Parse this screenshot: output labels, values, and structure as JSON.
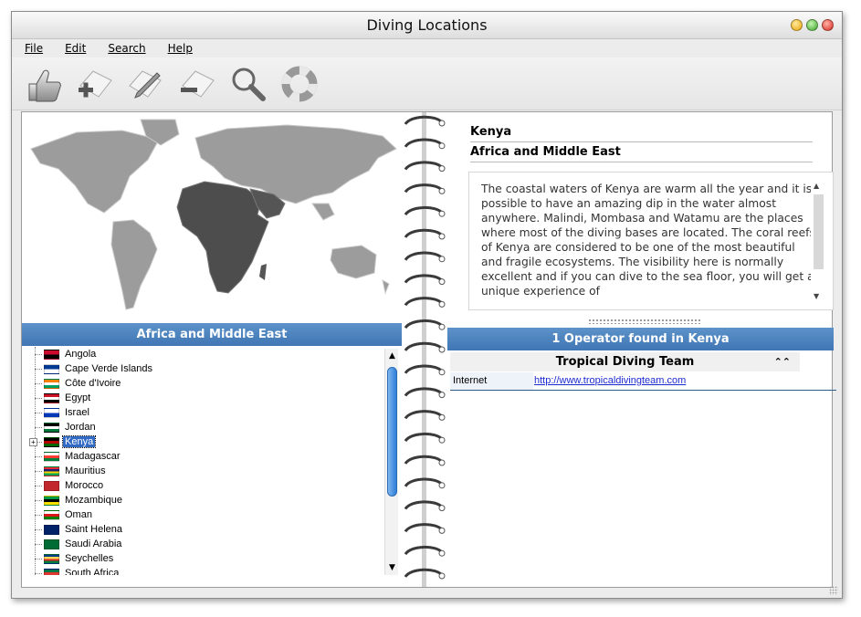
{
  "window": {
    "title": "Diving Locations"
  },
  "menubar": {
    "items": [
      "File",
      "Edit",
      "Search",
      "Help"
    ]
  },
  "toolbar": {
    "tools": [
      "thumbs-up-icon",
      "add-location-icon",
      "edit-location-icon",
      "remove-location-icon",
      "magnifier-icon",
      "lifebuoy-icon"
    ]
  },
  "left_panel": {
    "region_title": "Africa and Middle East",
    "countries": [
      {
        "label": "Angola",
        "flag": [
          "#cc092f",
          "#000000"
        ]
      },
      {
        "label": "Cape Verde Islands",
        "flag": [
          "#003893",
          "#ffffff"
        ]
      },
      {
        "label": "Côte d'Ivoire",
        "flag": [
          "#f77f00",
          "#ffffff",
          "#009e60"
        ]
      },
      {
        "label": "Egypt",
        "flag": [
          "#ce1126",
          "#ffffff",
          "#000000"
        ]
      },
      {
        "label": "Israel",
        "flag": [
          "#ffffff",
          "#0038b8"
        ]
      },
      {
        "label": "Jordan",
        "flag": [
          "#000000",
          "#ffffff",
          "#007a3d"
        ]
      },
      {
        "label": "Kenya",
        "flag": [
          "#000000",
          "#bb0000",
          "#006600"
        ],
        "selected": true,
        "expandable": true
      },
      {
        "label": "Madagascar",
        "flag": [
          "#ffffff",
          "#fc3d32",
          "#007e3a"
        ]
      },
      {
        "label": "Mauritius",
        "flag": [
          "#ea2839",
          "#1a206d",
          "#ffd500",
          "#00a551"
        ]
      },
      {
        "label": "Morocco",
        "flag": [
          "#c1272d"
        ]
      },
      {
        "label": "Mozambique",
        "flag": [
          "#009a44",
          "#000000",
          "#fce100"
        ]
      },
      {
        "label": "Oman",
        "flag": [
          "#ffffff",
          "#db161b",
          "#008000"
        ]
      },
      {
        "label": "Saint Helena",
        "flag": [
          "#012169"
        ]
      },
      {
        "label": "Saudi Arabia",
        "flag": [
          "#006c35"
        ]
      },
      {
        "label": "Seychelles",
        "flag": [
          "#003f87",
          "#fcd856",
          "#d62828",
          "#007a3d"
        ]
      },
      {
        "label": "South Africa",
        "flag": [
          "#007749",
          "#de3831",
          "#002395"
        ]
      }
    ]
  },
  "right_panel": {
    "location_name": "Kenya",
    "region_name": "Africa and Middle East",
    "description": "The coastal waters of Kenya are warm all the year and it is possible to have an amazing dip in the water almost anywhere. Malindi, Mombasa and Watamu are the places where most of the diving bases are located. The coral reefs of Kenya are considered to be one of the most beautiful and fragile ecosystems. The visibility here is normally excellent and if you can dive to the sea floor, you will get a unique experience of",
    "operators_title": "1 Operator found in Kenya",
    "operator": {
      "name": "Tropical Diving Team",
      "key": "Internet",
      "url": "http://www.tropicaldivingteam.com"
    }
  },
  "colors": {
    "accent_bar": "#4a82be",
    "selection": "#316ac5"
  }
}
